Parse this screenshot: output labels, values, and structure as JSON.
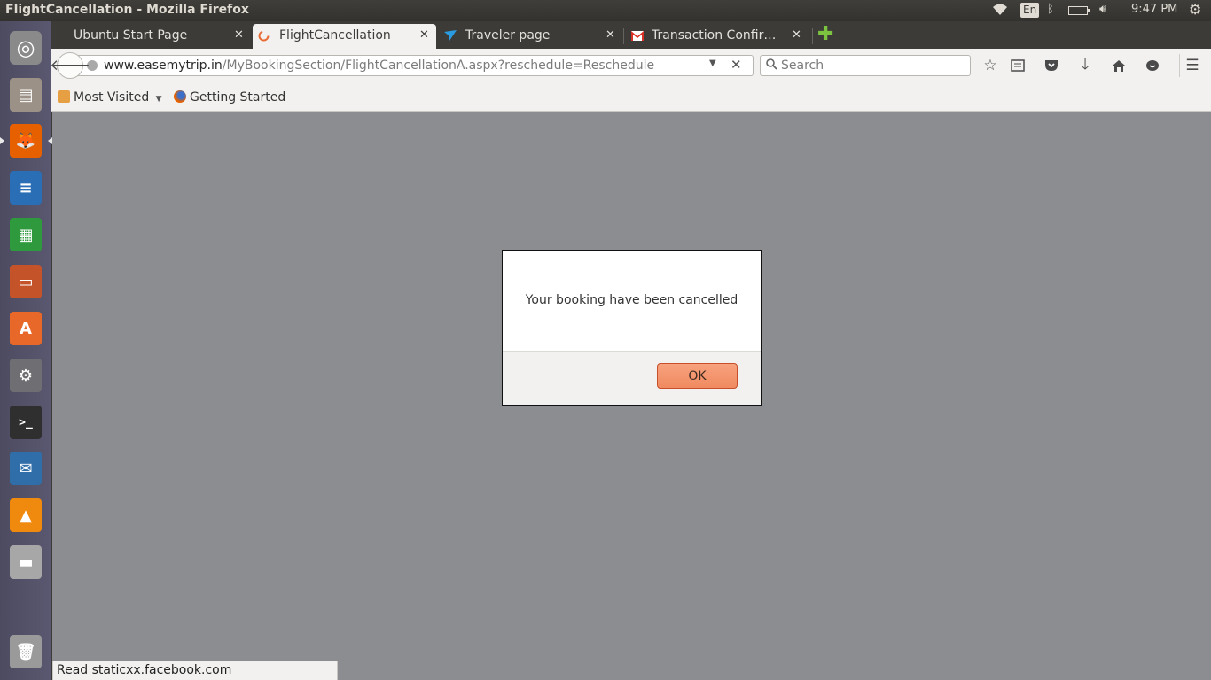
{
  "window": {
    "title": "FlightCancellation - Mozilla Firefox"
  },
  "panel": {
    "keyboard_layout": "En",
    "time": "9:47 PM"
  },
  "launcher": {
    "items": [
      {
        "name": "dash-home",
        "color": "#8a8a8a",
        "glyph": "◎"
      },
      {
        "name": "files",
        "color": "#9c9186",
        "glyph": "▤"
      },
      {
        "name": "firefox",
        "color": "#e66000",
        "glyph": "🦊"
      },
      {
        "name": "libreoffice-writer",
        "color": "#2a6eb5",
        "glyph": "≡"
      },
      {
        "name": "libreoffice-calc",
        "color": "#2f9a3d",
        "glyph": "▦"
      },
      {
        "name": "libreoffice-impress",
        "color": "#c5532a",
        "glyph": "▭"
      },
      {
        "name": "software-center",
        "color": "#e8682a",
        "glyph": "A"
      },
      {
        "name": "system-settings",
        "color": "#6f6f73",
        "glyph": "⚙"
      },
      {
        "name": "terminal",
        "color": "#2f2f2f",
        "glyph": ">_"
      },
      {
        "name": "thunderbird",
        "color": "#2f6ea8",
        "glyph": "✉"
      },
      {
        "name": "vlc",
        "color": "#f08a0e",
        "glyph": "▲"
      },
      {
        "name": "disk",
        "color": "#a7a7a7",
        "glyph": "▬"
      },
      {
        "name": "trash",
        "color": "#9a9a9a",
        "glyph": "🗑"
      }
    ]
  },
  "tabs": [
    {
      "label": "Ubuntu Start Page",
      "active": false
    },
    {
      "label": "FlightCancellation",
      "active": true
    },
    {
      "label": "Traveler page",
      "active": false
    },
    {
      "label": "Transaction Confir…",
      "active": false
    }
  ],
  "urlbar": {
    "domain": "www.easemytrip.in",
    "path": "/MyBookingSection/FlightCancellationA.aspx?reschedule=Reschedule"
  },
  "search": {
    "placeholder": "Search"
  },
  "bookmarks": {
    "most_visited": "Most Visited",
    "getting_started": "Getting Started"
  },
  "dialog": {
    "message": "Your booking have been cancelled",
    "ok_label": "OK"
  },
  "statusbar": {
    "text": "Read staticxx.facebook.com"
  },
  "colors": {
    "content_bg": "#8c8d90",
    "ok_button": "#f08a60",
    "panel": "#3c3b37"
  }
}
